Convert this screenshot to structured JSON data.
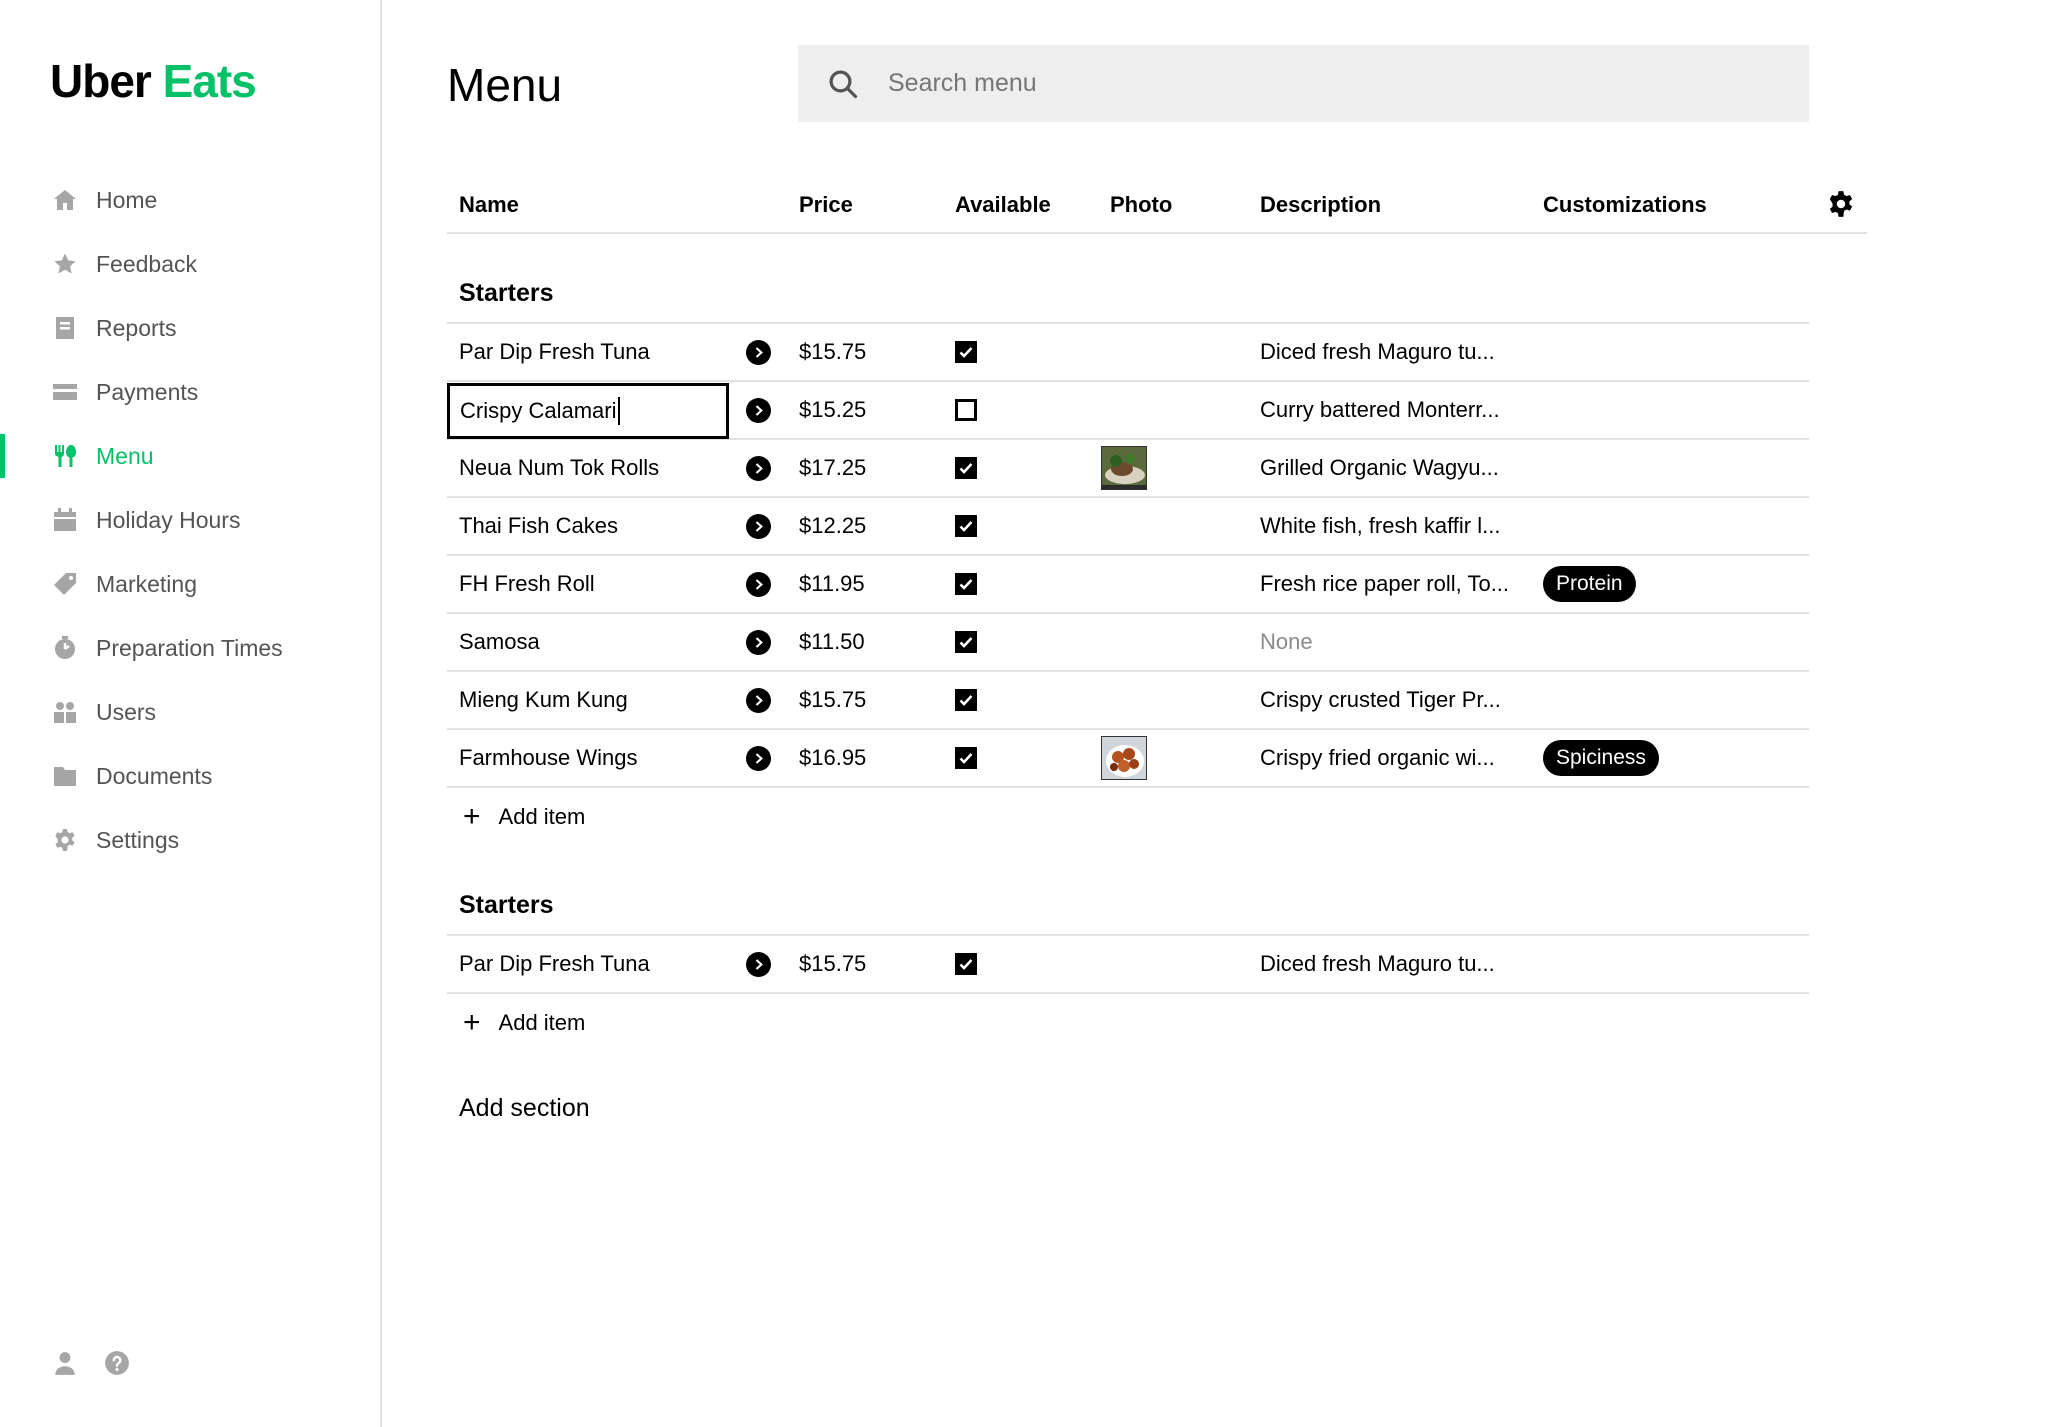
{
  "brand": {
    "name_part1": "Uber",
    "name_part2": "Eats",
    "accent_color": "#06c167"
  },
  "sidebar": {
    "items": [
      {
        "label": "Home",
        "icon": "home-icon",
        "active": false
      },
      {
        "label": "Feedback",
        "icon": "star-icon",
        "active": false
      },
      {
        "label": "Reports",
        "icon": "report-icon",
        "active": false
      },
      {
        "label": "Payments",
        "icon": "credit-card-icon",
        "active": false
      },
      {
        "label": "Menu",
        "icon": "utensils-icon",
        "active": true
      },
      {
        "label": "Holiday Hours",
        "icon": "calendar-icon",
        "active": false
      },
      {
        "label": "Marketing",
        "icon": "tag-icon",
        "active": false
      },
      {
        "label": "Preparation Times",
        "icon": "timer-icon",
        "active": false
      },
      {
        "label": "Users",
        "icon": "users-icon",
        "active": false
      },
      {
        "label": "Documents",
        "icon": "folder-icon",
        "active": false
      },
      {
        "label": "Settings",
        "icon": "gear-icon",
        "active": false
      }
    ],
    "bottom_icons": [
      "user-icon",
      "help-icon"
    ]
  },
  "header": {
    "title": "Menu",
    "search_placeholder": "Search menu"
  },
  "table": {
    "columns": [
      "Name",
      "Price",
      "Available",
      "Photo",
      "Description",
      "Customizations"
    ]
  },
  "sections": [
    {
      "title": "Starters",
      "items": [
        {
          "name": "Par Dip Fresh Tuna",
          "price": "$15.75",
          "available": true,
          "photo": false,
          "description": "Diced fresh Maguro tu...",
          "customization": ""
        },
        {
          "name": "Crispy Calamari",
          "price": "$15.25",
          "available": false,
          "photo": false,
          "description": "Curry battered Monterr...",
          "customization": "",
          "editing": true
        },
        {
          "name": "Neua Num Tok Rolls",
          "price": "$17.25",
          "available": true,
          "photo": true,
          "description": "Grilled Organic Wagyu...",
          "customization": ""
        },
        {
          "name": "Thai Fish Cakes",
          "price": "$12.25",
          "available": true,
          "photo": false,
          "description": "White fish, fresh kaffir l...",
          "customization": ""
        },
        {
          "name": "FH Fresh Roll",
          "price": "$11.95",
          "available": true,
          "photo": false,
          "description": "Fresh rice paper roll, To...",
          "customization": "Protein"
        },
        {
          "name": "Samosa",
          "price": "$11.50",
          "available": true,
          "photo": false,
          "description": "None",
          "customization": "",
          "desc_none": true
        },
        {
          "name": "Mieng Kum Kung",
          "price": "$15.75",
          "available": true,
          "photo": false,
          "description": "Crispy crusted Tiger Pr...",
          "customization": ""
        },
        {
          "name": "Farmhouse Wings",
          "price": "$16.95",
          "available": true,
          "photo": true,
          "description": "Crispy fried organic wi...",
          "customization": "Spiciness"
        }
      ],
      "add_item_label": "Add item"
    },
    {
      "title": "Starters",
      "items": [
        {
          "name": "Par Dip Fresh Tuna",
          "price": "$15.75",
          "available": true,
          "photo": false,
          "description": "Diced fresh Maguro tu...",
          "customization": ""
        }
      ],
      "add_item_label": "Add item"
    }
  ],
  "add_section_label": "Add section"
}
